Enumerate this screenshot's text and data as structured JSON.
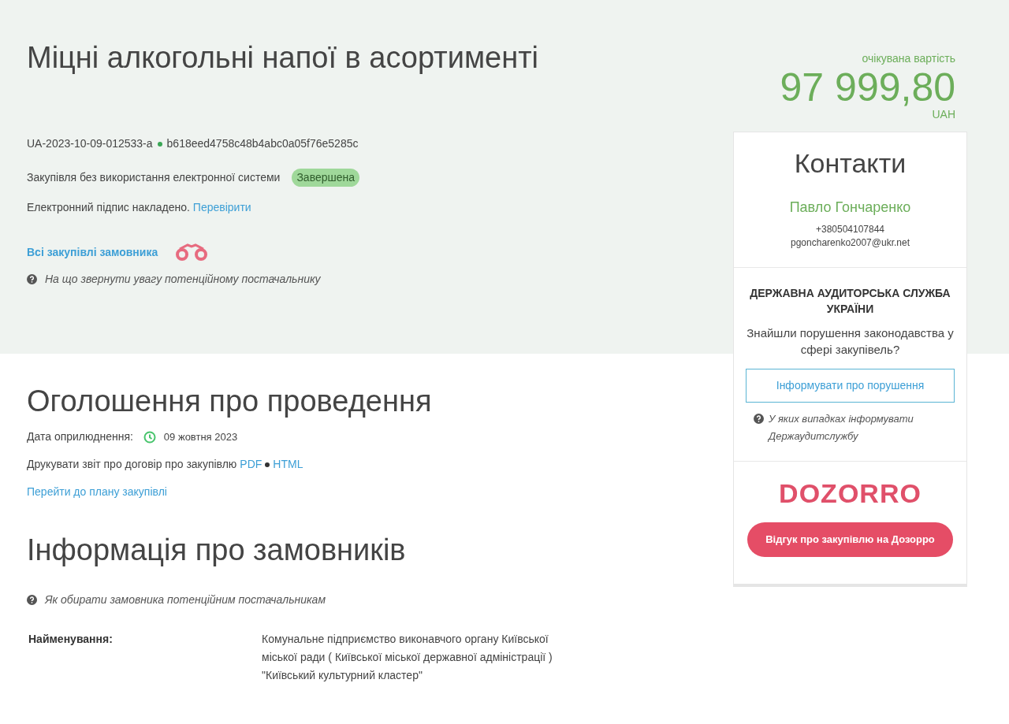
{
  "header": {
    "title": "Міцні алкогольні напої в асортименті",
    "procurement_id": "UA-2023-10-09-012533-a",
    "hash": "b618eed4758c48b4abc0a05f76e5285c",
    "procurement_type": "Закупівля без використання електронної системи",
    "status": "Завершена",
    "signature_text": "Електронний підпис накладено.",
    "signature_link": "Перевірити",
    "all_purchases_link": "Всі закупівлі замовника",
    "supplier_hint": "На що звернути увагу потенційному постачальнику"
  },
  "price": {
    "label": "очікувана вартість",
    "amount": "97 999,80",
    "currency": "UAH"
  },
  "contacts": {
    "title": "Контакти",
    "name": "Павло Гончаренко",
    "phone": "+380504107844",
    "email": "pgoncharenko2007@ukr.net"
  },
  "audit": {
    "title": "ДЕРЖАВНА АУДИТОРСЬКА СЛУЖБА УКРАЇНИ",
    "question": "Знайшли порушення законодавства у сфері закупівель?",
    "button": "Інформувати про порушення",
    "hint": "У яких випадках інформувати Держаудитслужбу"
  },
  "dozorro": {
    "logo": "DOZORRO",
    "button": "Відгук про закупівлю на Дозорро"
  },
  "announcement": {
    "title": "Оголошення про проведення",
    "date_label": "Дата оприлюднення:",
    "date": "09 жовтня 2023",
    "print_label": "Друкувати звіт про договір про закупівлю",
    "pdf_link": "PDF",
    "html_link": "HTML",
    "plan_link": "Перейти до плану закупівлі"
  },
  "customers": {
    "title": "Інформація про замовників",
    "hint": "Як обирати замовника потенційним постачальникам",
    "fields": [
      {
        "label": "Найменування:",
        "value": "Комунальне підприємство виконавчого органу Київської міської ради ( Київської міської державної адміністрації ) \"Київський культурний кластер\""
      }
    ]
  }
}
